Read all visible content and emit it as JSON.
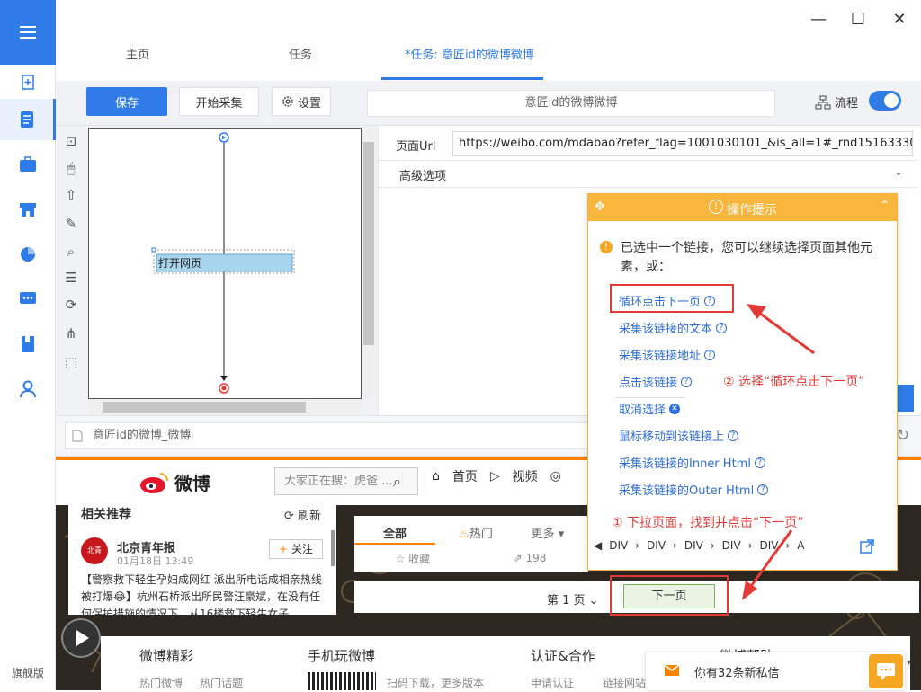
{
  "sidebar": {
    "flagship_label": "旗舰版",
    "icons": [
      "menu-icon",
      "new-task-icon",
      "document-icon",
      "briefcase-icon",
      "store-icon",
      "pie-chart-icon",
      "chat-icon",
      "book-icon",
      "user-icon"
    ]
  },
  "tabs": [
    {
      "label": "主页"
    },
    {
      "label": "任务"
    },
    {
      "label": "*任务: 意匠id的微博微博"
    }
  ],
  "toolbar": {
    "save_label": "保存",
    "collect_label": "开始采集",
    "settings_label": "设置",
    "task_name": "意匠id的微博微博",
    "flow_label": "流程"
  },
  "designer": {
    "node_label": "打开网页"
  },
  "props": {
    "url_label": "页面Url",
    "url_value": "https://weibo.com/mdabao?refer_flag=1001030101_&is_all=1#_rnd1516333013",
    "advanced_label": "高级选项"
  },
  "browser": {
    "address": "意匠id的微博_微博"
  },
  "weibo": {
    "logo_text": "微博",
    "search_placeholder": "大家正在搜：虎爸 ...",
    "nav": [
      "首页",
      "视频"
    ],
    "rec_title": "相关推荐",
    "rec_refresh": "刷新",
    "rec_name": "北京青年报",
    "rec_time": "01月18日 13:49",
    "rec_follow": "关注",
    "rec_text": "【警察救下轻生孕妇成网红 派出所电话成相亲热线被打爆😂】杭州石桥派出所民警汪豪斌，在没有任何保护措施的情况下，从16楼救下轻生女子...",
    "feed_tabs": [
      "全部",
      "热门",
      "更多"
    ],
    "stat_collect": "收藏",
    "stat_share": "198",
    "page_label": "第 1 页",
    "next_label": "下一页",
    "footer_titles": [
      "微博精彩",
      "手机玩微博",
      "认证&合作",
      "微博帮助"
    ],
    "footer_links": [
      "热门微博",
      "热门话题",
      "扫码下载，更多版本",
      "申请认证",
      "链接网站"
    ],
    "message": "你有32条新私信"
  },
  "tip": {
    "title": "操作提示",
    "message": "已选中一个链接，您可以继续选择页面其他元素，或：",
    "options": [
      "循环点击下一页",
      "采集该链接的文本",
      "采集该链接地址",
      "点击该链接",
      "取消选择",
      "鼠标移动到该链接上",
      "采集该链接的Inner Html",
      "采集该链接的Outer Html"
    ],
    "path": [
      "DIV",
      "DIV",
      "DIV",
      "DIV",
      "DIV",
      "A"
    ]
  },
  "annotations": {
    "step1": "① 下拉页面，找到并点击“下一页”",
    "step2": "② 选择“循环点击下一页”"
  },
  "colors": {
    "accent": "#2f7ce8",
    "tip_header": "#f8b63c",
    "annotation_red": "#e53935",
    "weibo_orange": "#ff8200"
  }
}
